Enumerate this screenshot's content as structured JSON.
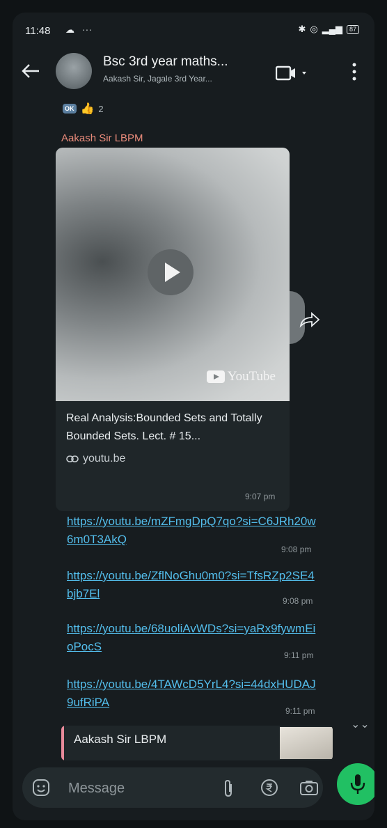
{
  "status_bar": {
    "time": "11:48",
    "dots": "···",
    "battery": "87"
  },
  "header": {
    "title": "Bsc 3rd year maths...",
    "subtitle": "Aakash Sir, Jagale 3rd Year..."
  },
  "reactions": {
    "badge": "OK",
    "count": "2"
  },
  "media_message": {
    "sender": "Aakash Sir LBPM",
    "youtube_label": "YouTube",
    "link_title": "Real Analysis:Bounded Sets and Totally Bounded Sets. Lect. # 15...",
    "link_domain": "youtu.be",
    "time": "9:07 pm"
  },
  "link_messages": [
    {
      "url": "https://youtu.be/mZFmgDpQ7qo?si=C6JRh20w6m0T3AkQ",
      "time": "9:08 pm"
    },
    {
      "url": "https://youtu.be/ZflNoGhu0m0?si=TfsRZp2SE4bjb7El",
      "time": "9:08 pm"
    },
    {
      "url": "https://youtu.be/68uoliAvWDs?si=yaRx9fywmEioPocS",
      "time": "9:11 pm"
    },
    {
      "url": "https://youtu.be/4TAWcD5YrL4?si=44dxHUDAJ9ufRiPA",
      "time": "9:11 pm"
    }
  ],
  "reply_preview": {
    "sender": "Aakash Sir LBPM"
  },
  "input_bar": {
    "placeholder": "Message"
  },
  "colors": {
    "background": "#171c1f",
    "link": "#53bdeb",
    "sender_name": "#e88a7a",
    "mic_button": "#21c063"
  },
  "icons": [
    "back-arrow-icon",
    "video-call-icon",
    "more-options-icon",
    "thumbs-up-icon",
    "play-icon",
    "forward-icon",
    "link-icon",
    "scroll-down-icon",
    "sticker-icon",
    "attach-icon",
    "rupee-icon",
    "camera-icon",
    "mic-icon"
  ]
}
